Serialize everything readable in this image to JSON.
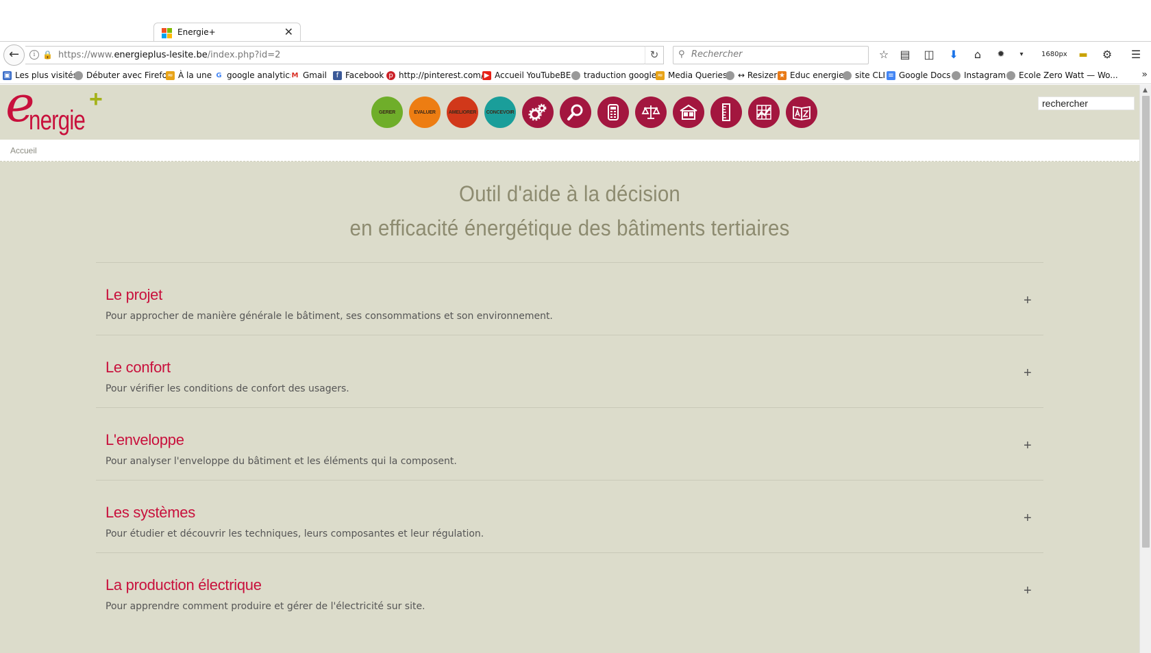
{
  "browser": {
    "tab": {
      "title": "Energie+",
      "close": "✕"
    },
    "url": {
      "prefix": "https://www.",
      "host": "energieplus-lesite.be",
      "path": "/index.php?id=2"
    },
    "search_placeholder": "Rechercher",
    "zoom_label": "1680px",
    "bookmarks": [
      "Les plus visités",
      "Débuter avec Firefox",
      "À la une",
      "google analytics",
      "Gmail",
      "Facebook",
      "http://pinterest.com/",
      "Accueil YouTubeBE",
      "traduction google",
      "Media Queries",
      "↔ Resizer",
      "Educ energie",
      "site CLI",
      "Google Docs",
      "Instagram",
      "Ecole Zero Watt — Wo..."
    ],
    "bookmarks_more": "»"
  },
  "site": {
    "logo": {
      "e": "e",
      "word": "nergie",
      "plus": "+"
    },
    "nav_buttons": [
      {
        "label": "GERER",
        "color": "#6fae2a"
      },
      {
        "label": "EVALUER",
        "color": "#ed7d12"
      },
      {
        "label": "AMELIORER",
        "color": "#d1381a"
      },
      {
        "label": "CONCEVOIR",
        "color": "#1a9e9a"
      }
    ],
    "nav_icons": [
      {
        "name": "gears-icon"
      },
      {
        "name": "magnifier-icon"
      },
      {
        "name": "calculator-icon"
      },
      {
        "name": "scale-icon"
      },
      {
        "name": "building-icon"
      },
      {
        "name": "ruler-icon"
      },
      {
        "name": "chart-icon"
      },
      {
        "name": "az-glossary-icon"
      }
    ],
    "icon_color": "#a3163f",
    "search_value": "rechercher",
    "breadcrumb": "Accueil",
    "headline": {
      "line1": "Outil d'aide à la décision",
      "line2": "en efficacité énergétique des bâtiments tertiaires"
    },
    "sections": [
      {
        "title": "Le projet",
        "desc": "Pour approcher de manière générale le bâtiment, ses consommations et son environnement.",
        "toggle": "+"
      },
      {
        "title": "Le confort",
        "desc": "Pour vérifier les conditions de confort des usagers.",
        "toggle": "+"
      },
      {
        "title": "L'enveloppe",
        "desc": "Pour analyser l'enveloppe du bâtiment et les éléments qui la composent.",
        "toggle": "+"
      },
      {
        "title": "Les systèmes",
        "desc": "Pour étudier et découvrir les techniques, leurs composantes et leur régulation.",
        "toggle": "+"
      },
      {
        "title": "La production électrique",
        "desc": "Pour apprendre comment produire et gérer de l'électricité sur site.",
        "toggle": "+"
      }
    ],
    "colors": {
      "accent": "#c8103c",
      "background": "#dcdccb",
      "headline": "#8d8b70"
    }
  }
}
